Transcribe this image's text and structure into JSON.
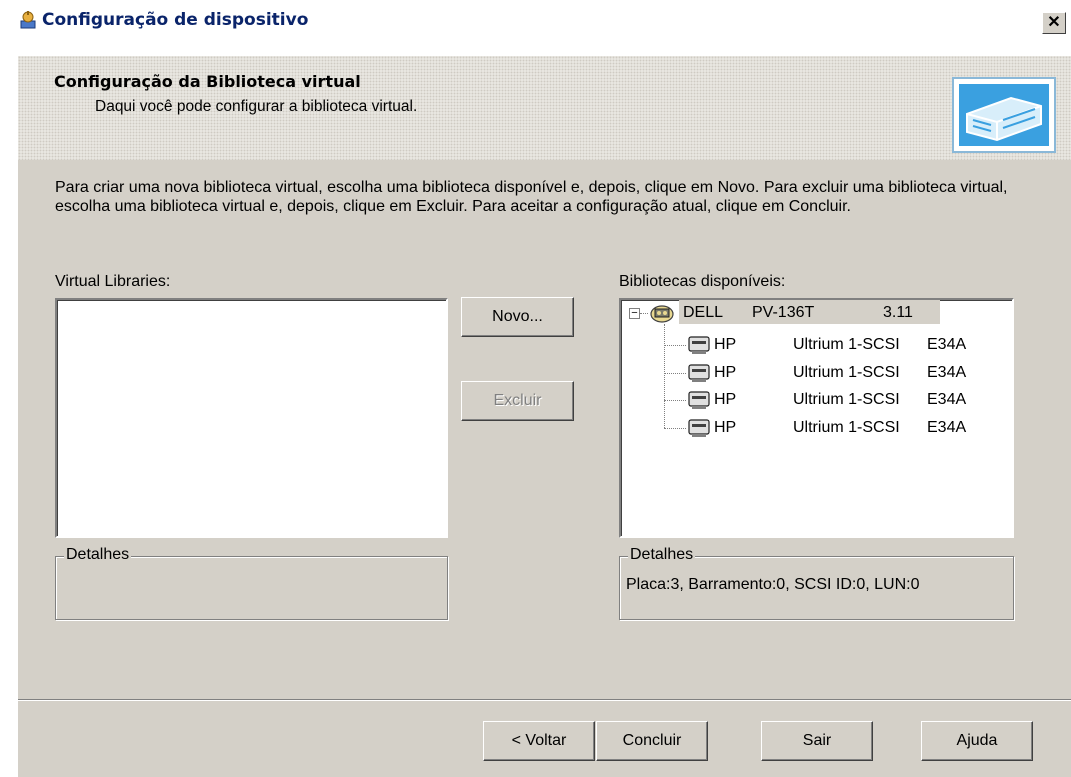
{
  "window": {
    "title": "Configuração de dispositivo",
    "close_label": "✕"
  },
  "header": {
    "title": "Configuração da Biblioteca virtual",
    "subtitle": "Daqui você pode configurar a biblioteca virtual."
  },
  "instructions": "Para criar uma nova biblioteca virtual, escolha uma biblioteca disponível e, depois, clique em Novo. Para excluir uma biblioteca virtual, escolha uma biblioteca virtual e, depois, clique em Excluir. Para aceitar a configuração atual, clique em Concluir.",
  "virtual_libraries": {
    "label": "Virtual Libraries:",
    "details_label": "Detalhes",
    "details_text": ""
  },
  "available_libraries": {
    "label": "Bibliotecas disponíveis:",
    "root": {
      "vendor": "DELL",
      "model": "PV-136T",
      "revision": "3.11"
    },
    "drives": [
      {
        "vendor": "HP",
        "model": "Ultrium 1-SCSI",
        "revision": "E34A"
      },
      {
        "vendor": "HP",
        "model": "Ultrium 1-SCSI",
        "revision": "E34A"
      },
      {
        "vendor": "HP",
        "model": "Ultrium 1-SCSI",
        "revision": "E34A"
      },
      {
        "vendor": "HP",
        "model": "Ultrium 1-SCSI",
        "revision": "E34A"
      }
    ],
    "details_label": "Detalhes",
    "details_text": "Placa:3, Barramento:0, SCSI ID:0, LUN:0"
  },
  "buttons": {
    "novo": "Novo...",
    "excluir": "Excluir",
    "voltar": "< Voltar",
    "concluir": "Concluir",
    "sair": "Sair",
    "ajuda": "Ajuda"
  },
  "icons": {
    "app": "device-config-icon",
    "banner": "tape-library-icon",
    "library": "library-icon",
    "drive": "tape-drive-icon"
  },
  "colors": {
    "title_text": "#0a246a",
    "dialog_face": "#d4d0c8",
    "banner_blue": "#3aa0e0"
  }
}
